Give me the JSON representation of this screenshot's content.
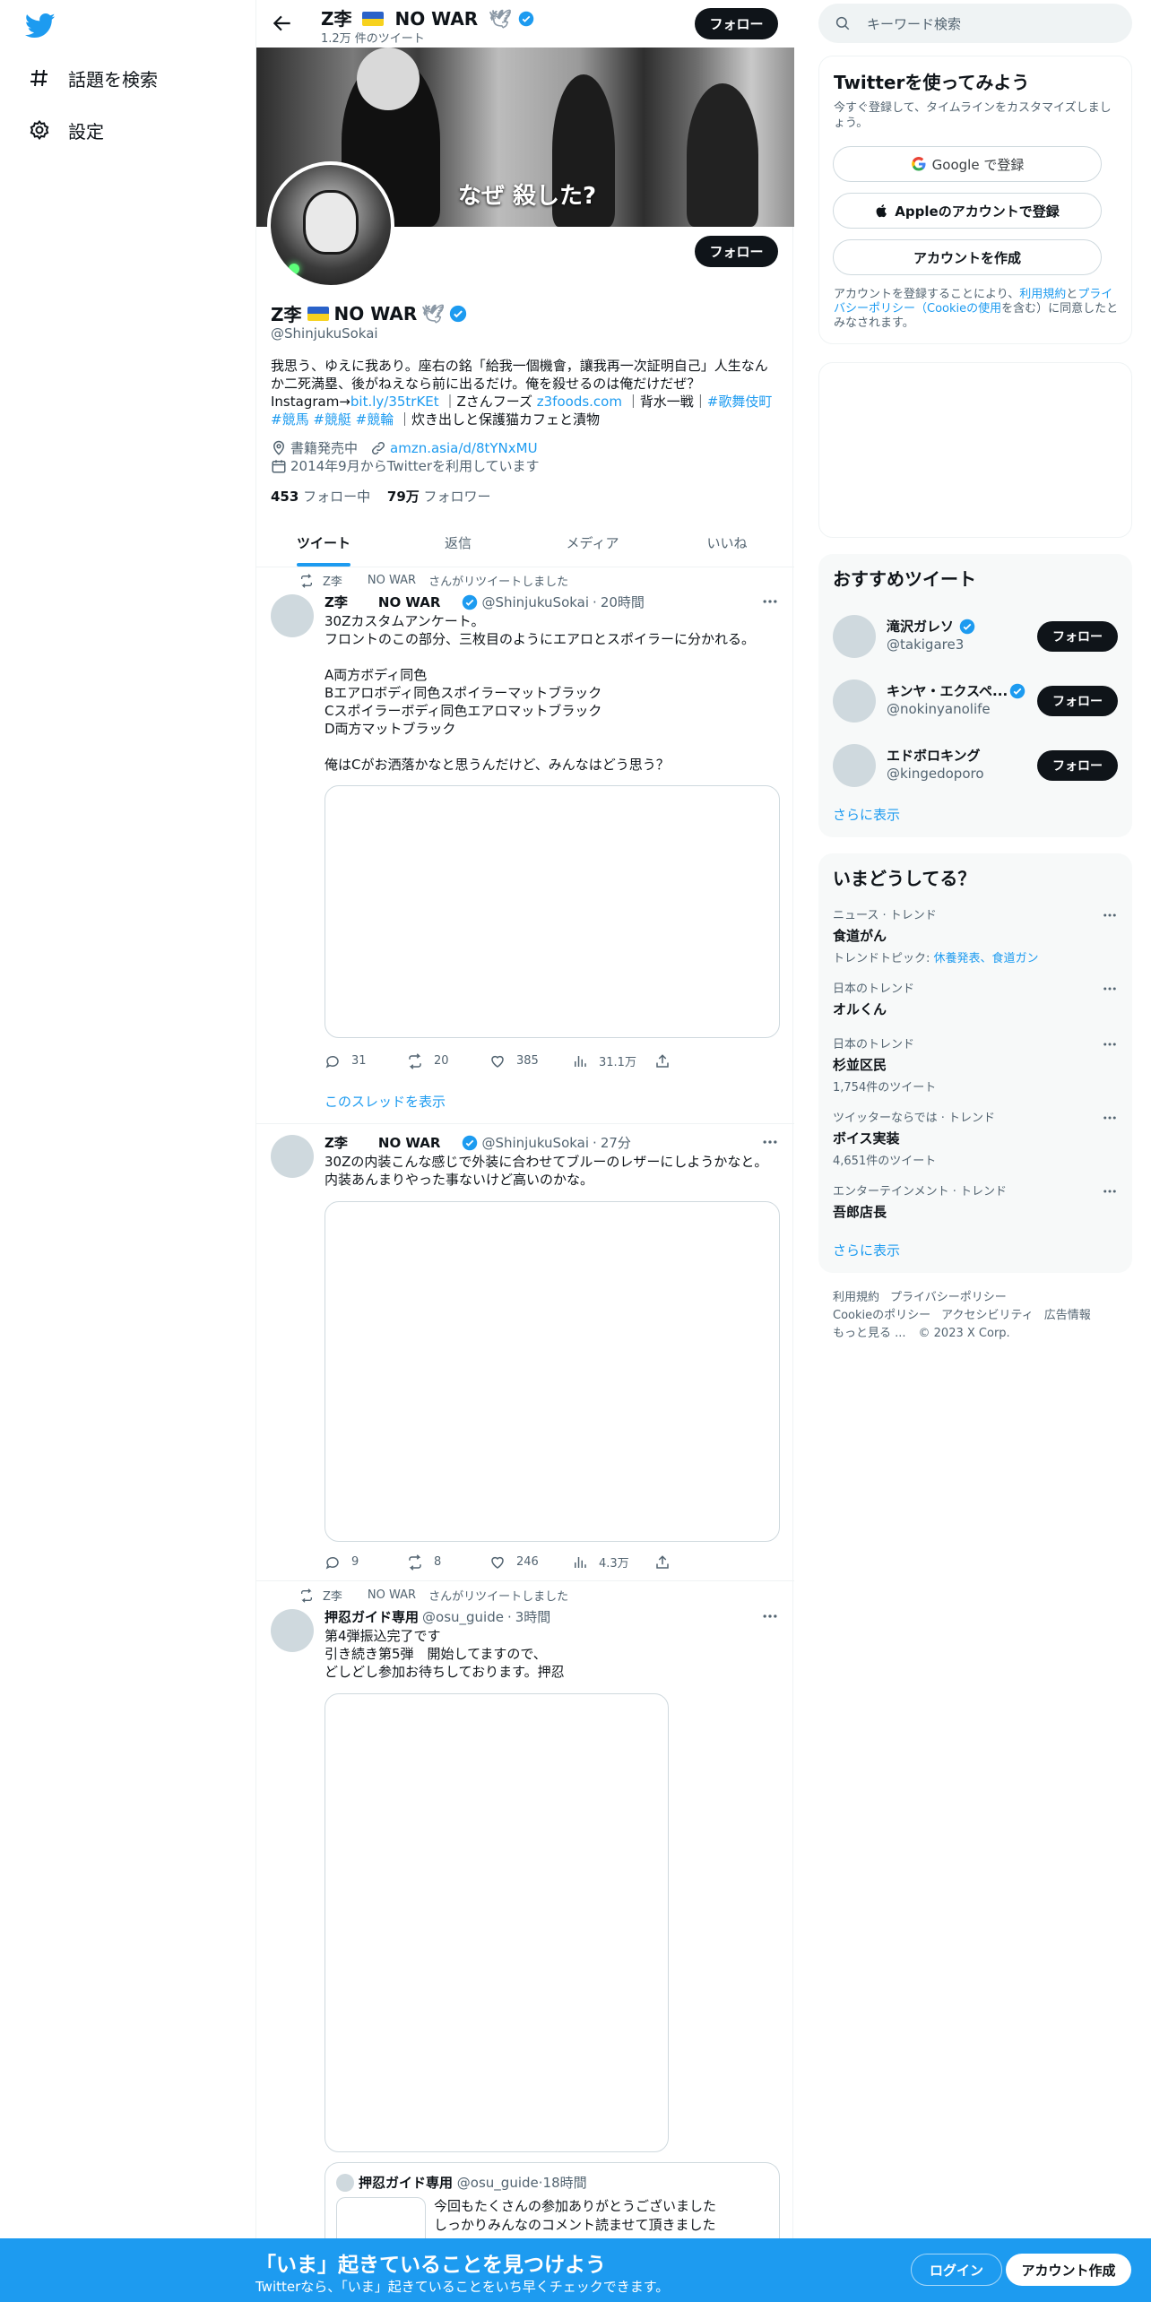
{
  "nav": {
    "explore_label": "話題を検索",
    "settings_label": "設定"
  },
  "header": {
    "name": "Z李",
    "name_suffix": "NO WAR",
    "tweet_count": "1.2万 件のツイート",
    "follow_label": "フォロー"
  },
  "banner": {
    "text": "なぜ 殺した?"
  },
  "profile": {
    "name": "Z李",
    "name_suffix": "NO WAR",
    "handle": "@ShinjukuSokai",
    "follow_label": "フォロー",
    "bio_line1": "我思う、ゆえに我あり。座右の銘「給我一個機會，讓我再一次証明自己」人生なんか二死満塁、後がねえなら前に出るだけ。俺を殺せるのは俺だけだぜ？",
    "bio_prefix": "Instagram→",
    "bio_link": "bit.ly/35trKEt",
    "bio_mid": "｜Zさんフーズ",
    "bio_link2": "z3foods.com",
    "bio_mid2": "｜背水一戦｜",
    "bio_tags": "#歌舞伎町 #競馬 #競艇 #競輪",
    "bio_end": "｜炊き出しと保護猫カフェと漬物",
    "category": "書籍発売中",
    "url": "amzn.asia/d/8tYNxMU",
    "joined": "2014年9月からTwitterを利用しています",
    "following_count": "453",
    "following_label": "フォロー中",
    "followers_count": "79万",
    "followers_label": "フォロワー"
  },
  "tabs": [
    "ツイート",
    "返信",
    "メディア",
    "いいね"
  ],
  "tweets": [
    {
      "retweet_by": "Z李",
      "retweet_suffix": "NO WAR",
      "retweet_text": "さんがリツイートしました",
      "author": "Z李",
      "author_suffix": "NO WAR",
      "handle": "@ShinjukuSokai",
      "time": "20時間",
      "text": "30Zカスタムアンケート。\nフロントのこの部分、三枚目のようにエアロとスポイラーに分かれる。\n\nA両方ボディ同色\nBエアロボディ同色スポイラーマットブラック\nCスポイラーボディ同色エアロマットブラック\nD両方マットブラック\n\n俺はCがお洒落かなと思うんだけど、みんなはどう思う？",
      "replies": "31",
      "retweets": "20",
      "likes": "385",
      "views": "31.1万",
      "show_thread": "このスレッドを表示"
    },
    {
      "author": "Z李",
      "author_suffix": "NO WAR",
      "handle": "@ShinjukuSokai",
      "time": "27分",
      "text": "30Zの内装こんな感じで外装に合わせてブルーのレザーにしようかなと。内装あんまりやった事ないけど高いのかな。",
      "replies": "9",
      "retweets": "8",
      "likes": "246",
      "views": "4.3万"
    },
    {
      "retweet_by": "Z李",
      "retweet_suffix": "NO WAR",
      "retweet_text": "さんがリツイートしました",
      "author": "押忍ガイド専用",
      "handle": "@osu_guide",
      "time": "3時間",
      "text": "第4弾振込完了です\n引き続き第5弾　開始してますので、\nどしどし参加お待ちしております。押忍",
      "quote_author": "押忍ガイド専用",
      "quote_handle": "@osu_guide",
      "quote_time": "18時間",
      "quote_text": "今回もたくさんの参加ありがとうございました\nしっかりみんなのコメント読ませて頂きました"
    }
  ],
  "right": {
    "search_placeholder": "キーワード検索",
    "signup": {
      "title": "Twitterを使ってみよう",
      "subtitle": "今すぐ登録して、タイムラインをカスタマイズしましょう。",
      "google": "Google で登録",
      "apple": "Appleのアカウントで登録",
      "create": "アカウントを作成",
      "legal_pre": "アカウントを登録することにより、",
      "legal_terms": "利用規約",
      "legal_and": "と",
      "legal_privacy": "プライバシーポリシー",
      "legal_cookie": "（Cookieの使用",
      "legal_post": "を含む）に同意したとみなされます。"
    },
    "recommend": {
      "title": "おすすめツイート",
      "users": [
        {
          "name": "滝沢ガレソ",
          "handle": "@takigare3",
          "verified": true
        },
        {
          "name": "キンヤ・エクスペ...",
          "handle": "@nokinyanolife",
          "verified": true
        },
        {
          "name": "エドボロキング",
          "handle": "@kingedoporo",
          "verified": false
        }
      ],
      "follow_label": "フォロー",
      "show_more": "さらに表示"
    },
    "trends": {
      "title": "いまどうしてる？",
      "items": [
        {
          "context": "ニュース · トレンド",
          "topic": "食道がん",
          "meta_pre": "トレンドトピック: ",
          "meta_link": "休養発表、食道ガン",
          "meta": ""
        },
        {
          "context": "日本のトレンド",
          "topic": "オルくん",
          "meta": ""
        },
        {
          "context": "日本のトレンド",
          "topic": "杉並区民",
          "meta": "1,754件のツイート"
        },
        {
          "context": "ツイッターならでは · トレンド",
          "topic": "ボイス実装",
          "meta": "4,651件のツイート"
        },
        {
          "context": "エンターテインメント · トレンド",
          "topic": "吾郎店長",
          "meta": ""
        }
      ],
      "show_more": "さらに表示"
    },
    "footer": {
      "terms": "利用規約",
      "privacy": "プライバシーポリシー",
      "cookie": "Cookieのポリシー",
      "accessibility": "アクセシビリティ",
      "ads": "広告情報",
      "more": "もっと見る ...",
      "copyright": "© 2023 X Corp."
    }
  },
  "bottom": {
    "title": "「いま」起きていることを見つけよう",
    "subtitle": "Twitterなら、「いま」起きていることをいち早くチェックできます。",
    "login": "ログイン",
    "signup": "アカウント作成"
  }
}
